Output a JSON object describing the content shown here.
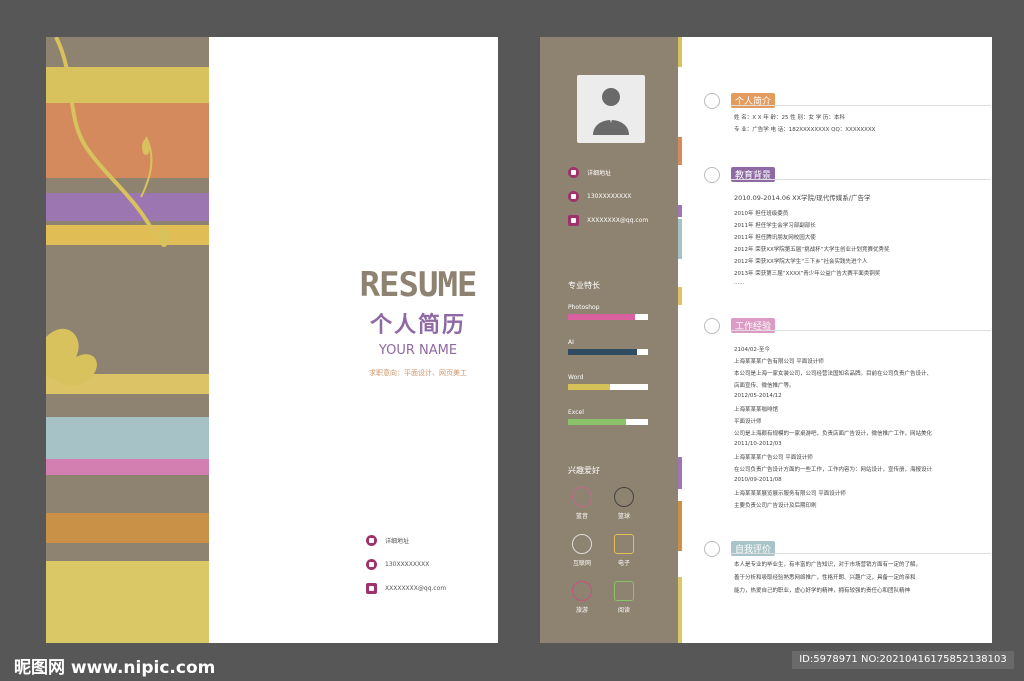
{
  "cover": {
    "title_en": "RESUME",
    "title_cn": "个人简历",
    "your_name": "YOUR NAME",
    "intent": "求职意向：平面设计、网页美工",
    "contacts": [
      {
        "icon": "home-icon",
        "text": "详细地址"
      },
      {
        "icon": "phone-icon",
        "text": "130XXXXXXXX"
      },
      {
        "icon": "mail-icon",
        "text": "XXXXXXXX@qq.com"
      }
    ]
  },
  "sidebar": {
    "contacts": [
      {
        "icon": "home-icon",
        "text": "详细地址"
      },
      {
        "icon": "phone-icon",
        "text": "130XXXXXXXX"
      },
      {
        "icon": "mail-icon",
        "text": "XXXXXXXX@qq.com"
      }
    ],
    "skills_heading": "专业特长",
    "skills": [
      {
        "name": "Photoshop",
        "level": 0.84,
        "color": "#d9619f"
      },
      {
        "name": "AI",
        "level": 0.86,
        "color": "#2f4a63"
      },
      {
        "name": "Word",
        "level": 0.53,
        "color": "#d6c058"
      },
      {
        "name": "Excel",
        "level": 0.72,
        "color": "#8cc26a"
      }
    ],
    "hobbies_heading": "兴趣爱好",
    "hobbies": [
      {
        "label": "篮音",
        "icon": "music-icon",
        "color": "#c26a8c"
      },
      {
        "label": "篮球",
        "icon": "basketball-icon",
        "color": "#444"
      },
      {
        "label": "互联网",
        "icon": "internet-icon",
        "color": "#ddd"
      },
      {
        "label": "电子",
        "icon": "electronics-icon",
        "color": "#e2c057"
      },
      {
        "label": "旅游",
        "icon": "travel-icon",
        "color": "#c94f83"
      },
      {
        "label": "阅读",
        "icon": "reading-icon",
        "color": "#8cc26a"
      }
    ]
  },
  "sections": {
    "profile": {
      "title": "个人简介",
      "color": "#e39b5e",
      "lines": [
        "姓 名：X X          年 龄：25          性 别：女          学 历：本科",
        "专 业：广告学          电 话：182XXXXXXXX          QQ：XXXXXXXX"
      ]
    },
    "education": {
      "title": "教育背景",
      "color": "#8f69a3",
      "header": "2010.09-2014.06     XX学院/现代传媒系/广告学",
      "lines": [
        "2010年    担任班级委员",
        "2011年    担任学生会学习部副部长",
        "2011年    担任腾讯朋友网校园大使",
        "2012年    荣获XX学院第五届“挑战杯”大学生创业计划竞赛优秀奖",
        "2012年    荣获XX学院大学生“三下乡”社会实践先进个人",
        "2013年    荣获第三届“XXXX”青少年公益广告大赛平面类铜奖",
        "......"
      ]
    },
    "work": {
      "title": "工作经验",
      "color": "#dc9bc4",
      "lines": [
        "2104/02-至今",
        "上海某某某广告有限公司    平面设计师",
        "本公司是上海一家女装公司，公司经营法国知名品牌。目前在公司负责广告设计、",
        "店面宣传、微信推广等。",
        "2012/05-2014/12",
        "上海某某某咖啡馆",
        "平面设计师",
        "公司是上海颇有规模的一家桌游吧，负责店面广告设计，微信推广工作，网站美化",
        "2011/10-2012/03",
        "上海某某某广告公司    平面设计师",
        "在公司负责广告设计方面的一些工作，工作内容为：网站设计，宣传册，海报设计",
        "2010/09-2011/08",
        "上海某某某展览展示服务有限公司    平面设计师",
        "主要负责公司广告设计及后期印刷"
      ]
    },
    "self": {
      "title": "自我评价",
      "color": "#a8c4c8",
      "lines": [
        "本人是专业的毕业生，有丰富的广告知识，对于市场营销方面有一定的了解，",
        "善于分析和吸取经验熟悉网络推广，性格开朗、兴趣广泛，具备一定的亲和",
        "能力，热爱自己的职业，虚心好学的精神，拥有较强的责任心和团队精神"
      ]
    }
  },
  "footer": {
    "logo": "昵图网 www.nipic.com",
    "id_text": "ID:5978971 NO:20210416175852138103"
  }
}
